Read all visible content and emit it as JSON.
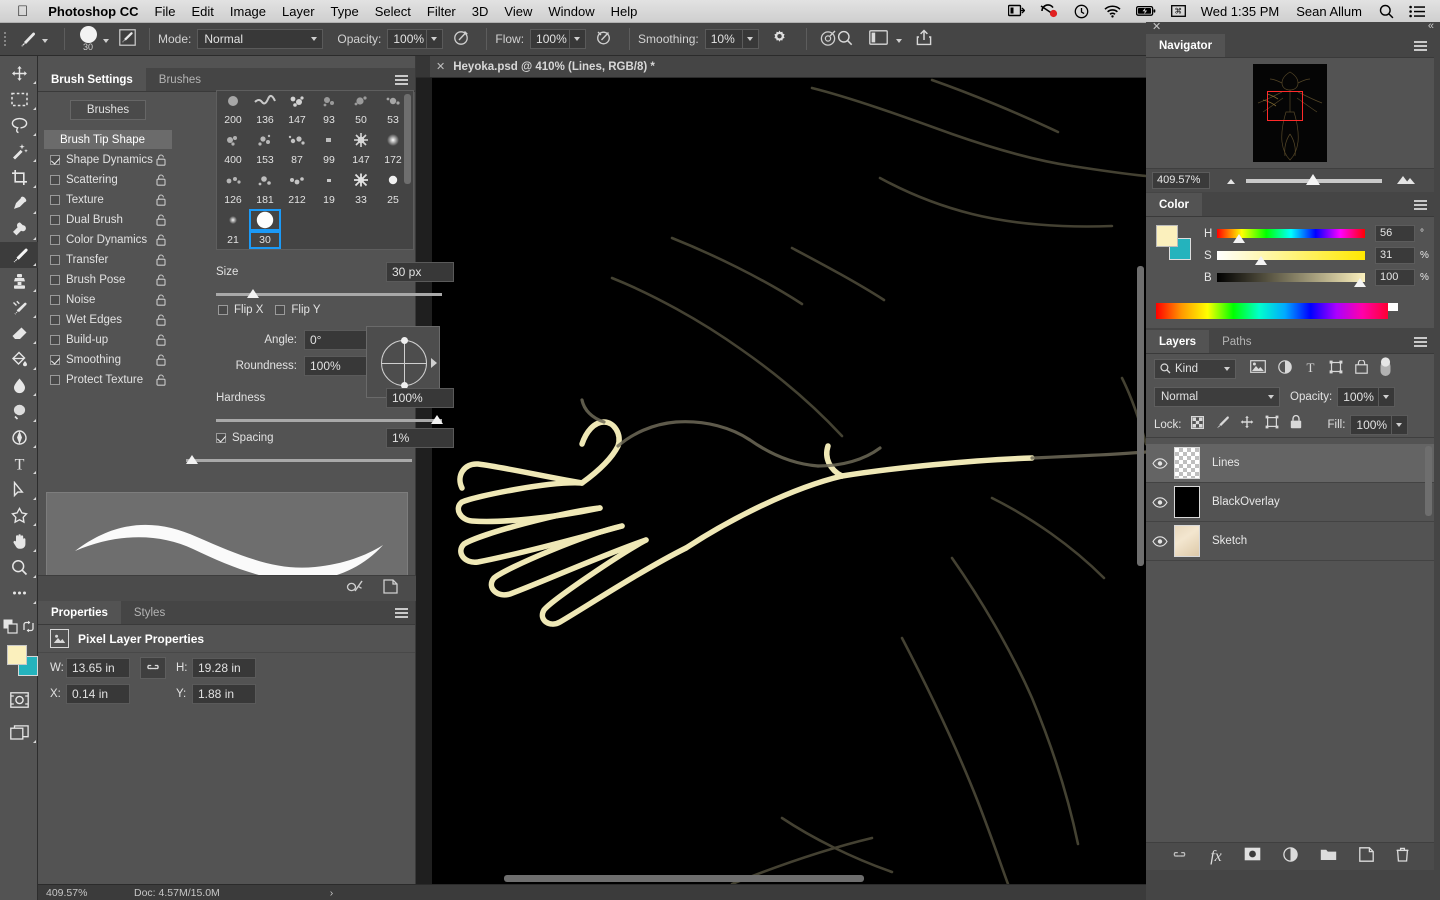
{
  "menubar": {
    "apple_icon": "apple-icon",
    "app_name": "Photoshop CC",
    "items": [
      "File",
      "Edit",
      "Image",
      "Layer",
      "Type",
      "Select",
      "Filter",
      "3D",
      "View",
      "Window",
      "Help"
    ],
    "status_icons": [
      "display-icon",
      "record-icon",
      "time-machine-icon",
      "wifi-icon",
      "battery-icon",
      "input-source-icon"
    ],
    "clock": "Wed 1:35 PM",
    "user": "Sean Allum",
    "search_icon": "search-icon",
    "control_center_icon": "control-center-icon"
  },
  "options_bar": {
    "tool_icon": "brush-tool-icon",
    "brush_size_badge": "30",
    "brush_panel_icon": "brush-panel-icon",
    "mode_label": "Mode:",
    "mode_value": "Normal",
    "opacity_label": "Opacity:",
    "opacity_value": "100%",
    "airbrush_icon": "airbrush-icon",
    "flow_label": "Flow:",
    "flow_value": "100%",
    "pressure_opacity_icon": "pressure-opacity-icon",
    "smoothing_label": "Smoothing:",
    "smoothing_value": "10%",
    "gear_icon": "gear-icon",
    "symmetry_icon": "symmetry-icon",
    "zoom_icon": "search-icon",
    "workspace_icon": "workspace-icon",
    "share_icon": "share-icon"
  },
  "toolbar": {
    "tools": [
      {
        "name": "move-tool"
      },
      {
        "name": "rectangular-marquee-tool"
      },
      {
        "name": "lasso-tool"
      },
      {
        "name": "quick-selection-tool"
      },
      {
        "name": "crop-tool"
      },
      {
        "name": "eyedropper-tool"
      },
      {
        "name": "healing-brush-tool"
      },
      {
        "name": "brush-tool",
        "selected": true
      },
      {
        "name": "clone-stamp-tool"
      },
      {
        "name": "history-brush-tool"
      },
      {
        "name": "eraser-tool"
      },
      {
        "name": "gradient-tool"
      },
      {
        "name": "blur-tool"
      },
      {
        "name": "dodge-tool"
      },
      {
        "name": "pen-tool"
      },
      {
        "name": "type-tool"
      },
      {
        "name": "path-selection-tool"
      },
      {
        "name": "shape-tool"
      },
      {
        "name": "hand-tool"
      },
      {
        "name": "zoom-tool"
      },
      {
        "name": "edit-toolbar-tool"
      }
    ],
    "color_swatches": {
      "foreground": "#fbf0bd",
      "background": "#24b3bd"
    },
    "quick_mask_icon": "quick-mask-icon",
    "screen_mode_icon": "screen-mode-icon"
  },
  "document": {
    "close_icon": "close-icon",
    "tab_title": "Heyoka.psd @ 410% (Lines, RGB/8) *"
  },
  "status_bar": {
    "zoom": "409.57%",
    "doc_info": "Doc: 4.57M/15.0M"
  },
  "brush_settings": {
    "close_icon": "close-icon",
    "collapse_icon": "collapse-icon",
    "menu_icon": "panel-menu-icon",
    "tabs": [
      {
        "label": "Brush Settings",
        "active": true
      },
      {
        "label": "Brushes",
        "active": false
      }
    ],
    "brushes_button": "Brushes",
    "dynamics": [
      {
        "label": "Brush Tip Shape",
        "header": true
      },
      {
        "label": "Shape Dynamics",
        "checked": true
      },
      {
        "label": "Scattering",
        "checked": false
      },
      {
        "label": "Texture",
        "checked": false
      },
      {
        "label": "Dual Brush",
        "checked": false
      },
      {
        "label": "Color Dynamics",
        "checked": false
      },
      {
        "label": "Transfer",
        "checked": false
      },
      {
        "label": "Brush Pose",
        "checked": false
      },
      {
        "label": "Noise",
        "checked": false
      },
      {
        "label": "Wet Edges",
        "checked": false
      },
      {
        "label": "Build-up",
        "checked": false
      },
      {
        "label": "Smoothing",
        "checked": true
      },
      {
        "label": "Protect Texture",
        "checked": false
      }
    ],
    "brush_grid": {
      "row1_sizes": [
        "200",
        "136",
        "147",
        "93",
        "50",
        "53"
      ],
      "row2_sizes": [
        "400",
        "153",
        "87",
        "99",
        "147",
        "172"
      ],
      "row3_sizes": [
        "126",
        "181",
        "212",
        "19",
        "33",
        "25"
      ],
      "row4_sizes": [
        "21",
        "30"
      ],
      "selected_size": "30"
    },
    "size_label": "Size",
    "size_value": "30 px",
    "flip_x_label": "Flip X",
    "flip_y_label": "Flip Y",
    "flip_x_checked": false,
    "flip_y_checked": false,
    "angle_label": "Angle:",
    "angle_value": "0°",
    "roundness_label": "Roundness:",
    "roundness_value": "100%",
    "hardness_label": "Hardness",
    "hardness_value": "100%",
    "spacing_label": "Spacing",
    "spacing_value": "1%",
    "spacing_checked": true,
    "footer_icons": [
      "toggle-brush-preview-icon",
      "new-brush-icon"
    ]
  },
  "properties": {
    "tabs": [
      {
        "label": "Properties",
        "active": true
      },
      {
        "label": "Styles",
        "active": false
      }
    ],
    "menu_icon": "panel-menu-icon",
    "header_icon": "pixel-layer-icon",
    "header_title": "Pixel Layer Properties",
    "fields": [
      {
        "label": "W:",
        "value": "13.65 in"
      },
      {
        "label": "H:",
        "value": "19.28 in"
      },
      {
        "label": "X:",
        "value": "0.14 in"
      },
      {
        "label": "Y:",
        "value": "1.88 in"
      }
    ],
    "link_icon": "link-icon"
  },
  "navigator": {
    "close_icon": "close-icon",
    "collapse_icon": "collapse-icon",
    "tab_label": "Navigator",
    "menu_icon": "panel-menu-icon",
    "zoom_value": "409.57%",
    "zoom_out_icon": "small-mountain-icon",
    "zoom_in_icon": "large-mountain-icon"
  },
  "color": {
    "tab_label": "Color",
    "menu_icon": "panel-menu-icon",
    "foreground": "#fbf0bd",
    "background": "#24b3bd",
    "channels": [
      {
        "label": "H",
        "value": "56",
        "unit": "°",
        "pos": 15
      },
      {
        "label": "S",
        "value": "31",
        "unit": "%",
        "pos": 31
      },
      {
        "label": "B",
        "value": "100",
        "unit": "%",
        "pos": 97
      }
    ]
  },
  "layers": {
    "tabs": [
      {
        "label": "Layers",
        "active": true
      },
      {
        "label": "Paths",
        "active": false
      }
    ],
    "menu_icon": "panel-menu-icon",
    "kind_label": "Kind",
    "filter_icons": [
      "pixel-filter-icon",
      "adjustment-filter-icon",
      "type-filter-icon",
      "shape-filter-icon",
      "smartobject-filter-icon"
    ],
    "filter_toggle_icon": "filter-toggle-icon",
    "blend_mode": "Normal",
    "opacity_label": "Opacity:",
    "opacity_value": "100%",
    "lock_label": "Lock:",
    "lock_icons": [
      "lock-transparency-icon",
      "lock-image-icon",
      "lock-position-icon",
      "lock-artboard-icon",
      "lock-all-icon"
    ],
    "fill_label": "Fill:",
    "fill_value": "100%",
    "rows": [
      {
        "name": "Lines",
        "visible": true,
        "thumb": "transparent",
        "active": true
      },
      {
        "name": "BlackOverlay",
        "visible": true,
        "thumb": "black",
        "active": false
      },
      {
        "name": "Sketch",
        "visible": true,
        "thumb": "paper",
        "active": false
      }
    ],
    "footer_icons": [
      "link-layers-icon",
      "fx-icon",
      "layer-mask-icon",
      "adjustment-layer-icon",
      "new-group-icon",
      "new-layer-icon",
      "delete-layer-icon"
    ]
  },
  "colors": {
    "panel_bg": "#535353",
    "dock_bg": "#454545",
    "accent": "#1b9af7",
    "artwork_line": "#f7f0bc",
    "nav_rect": "#ff2a2a"
  }
}
